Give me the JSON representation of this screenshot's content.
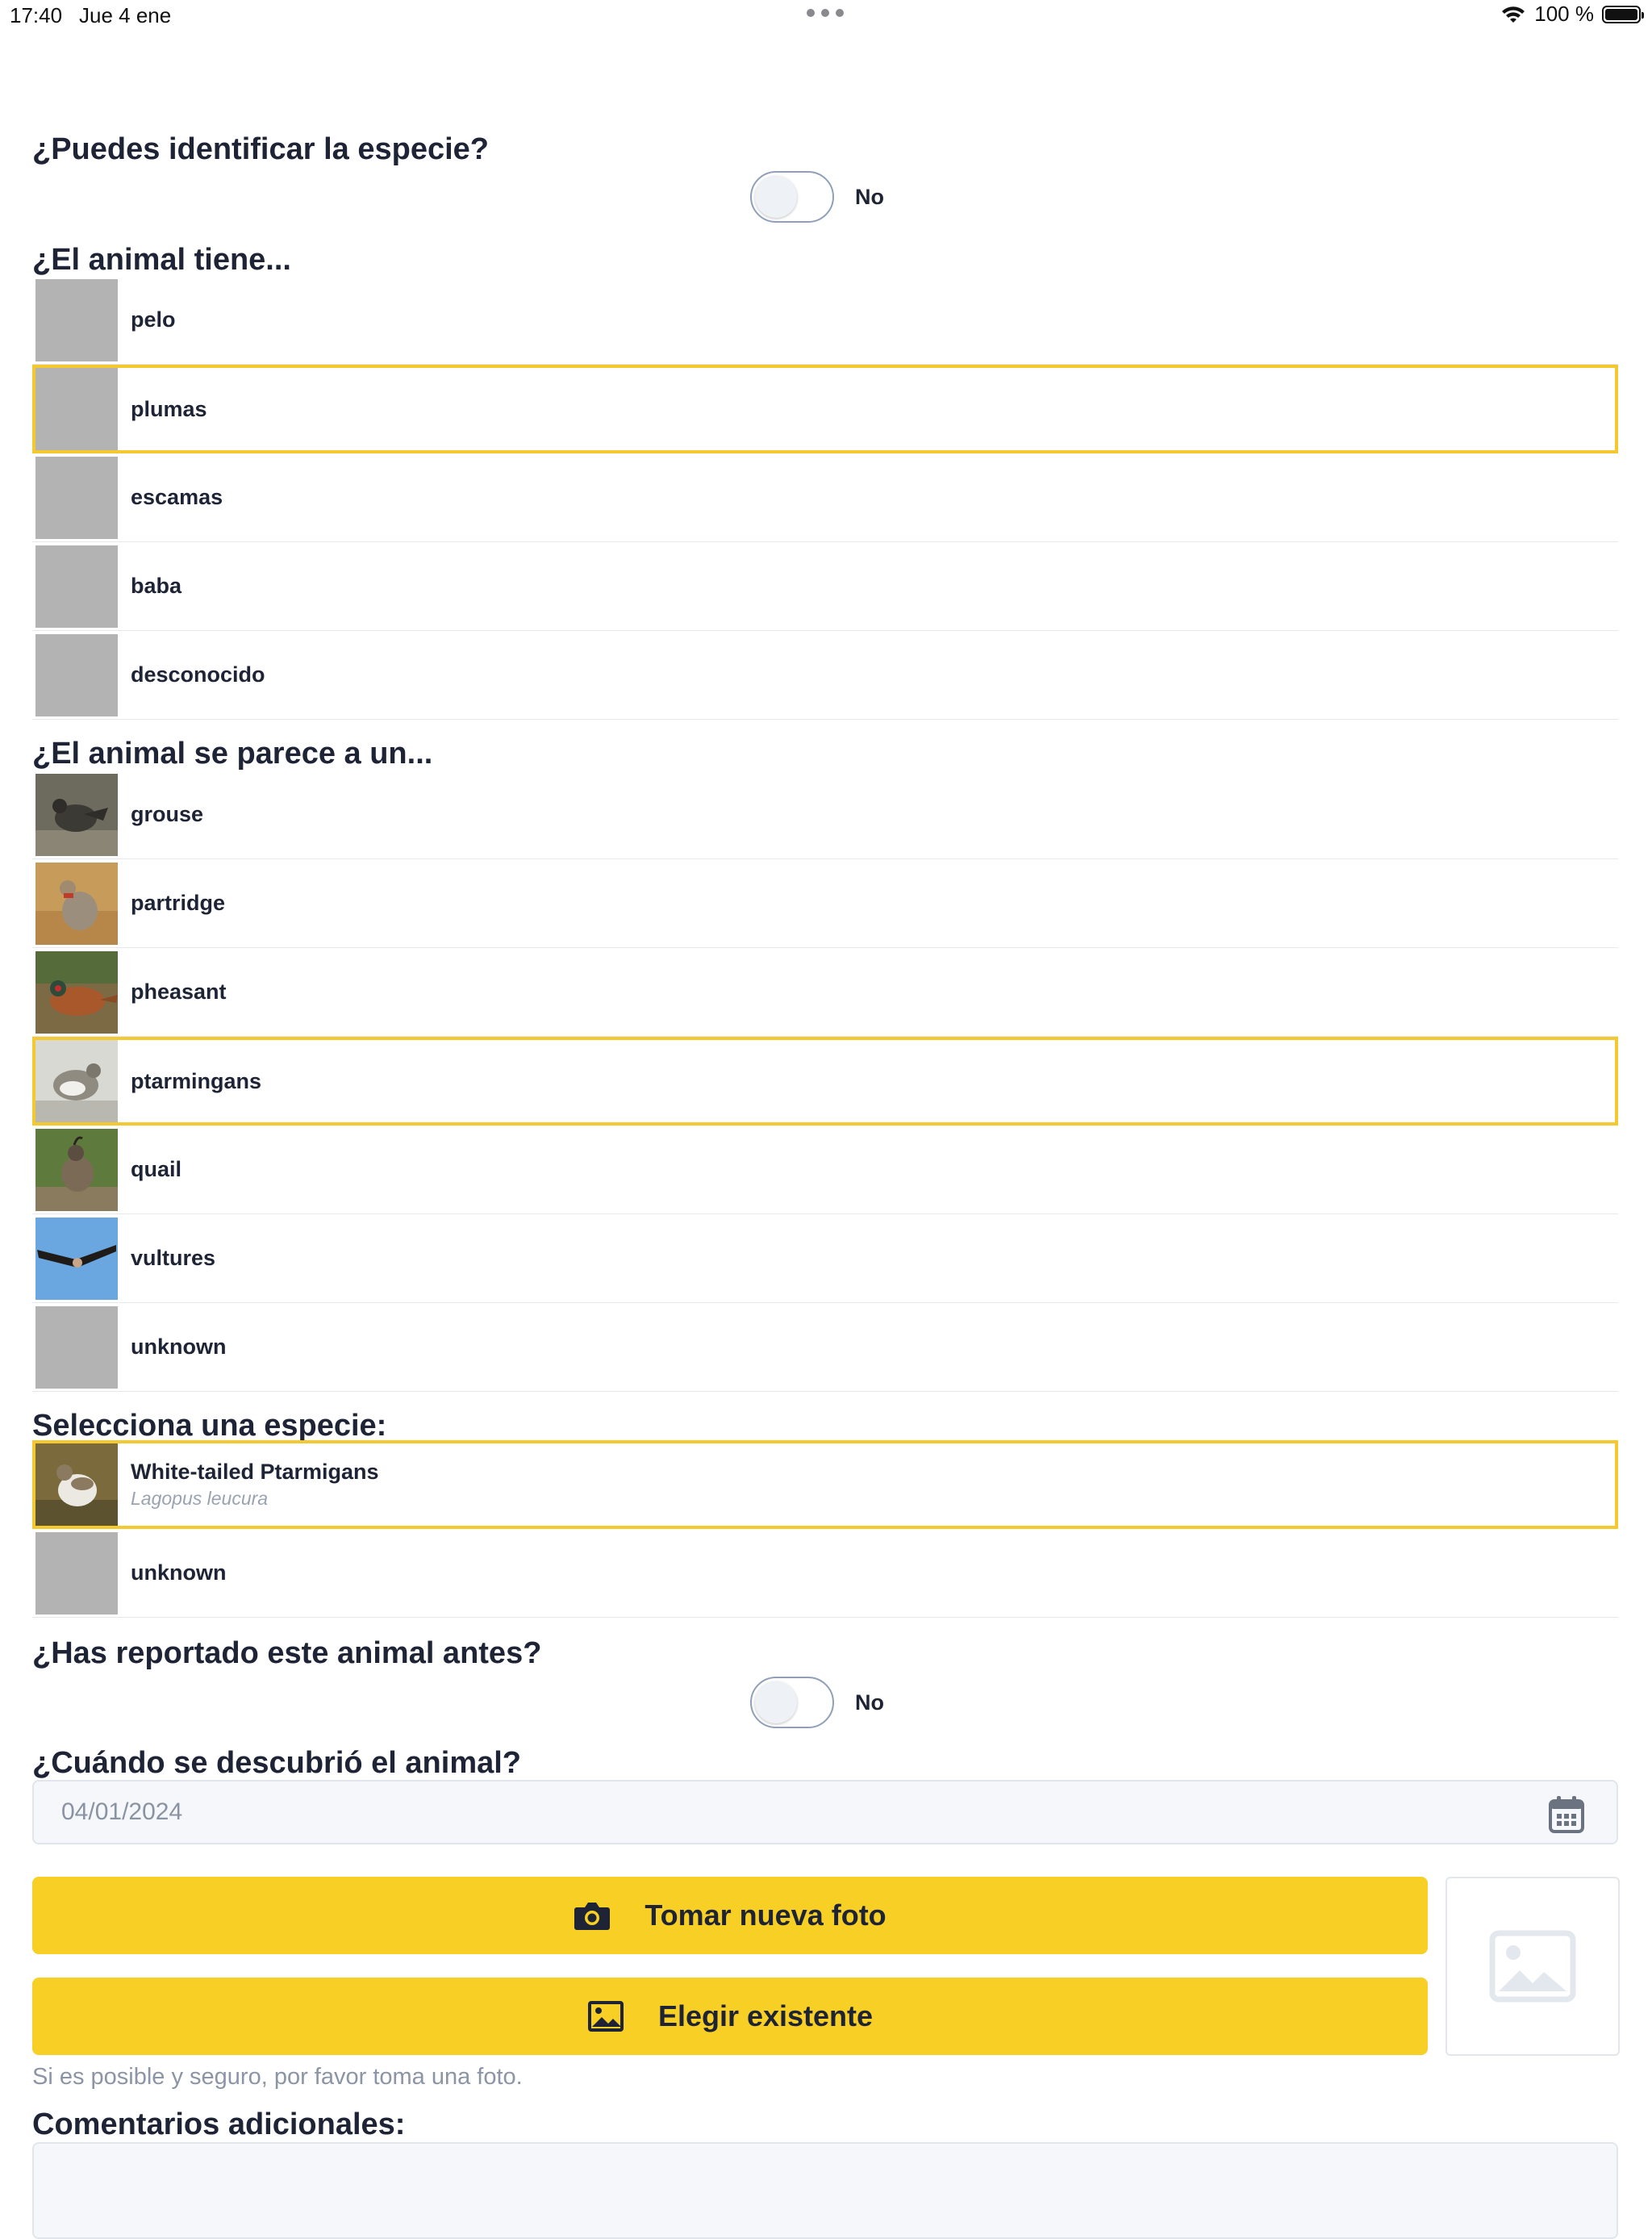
{
  "status_bar": {
    "time": "17:40",
    "date": "Jue 4 ene",
    "battery": "100 %"
  },
  "q_identify": {
    "title": "¿Puedes identificar la especie?",
    "toggle_label": "No"
  },
  "q_covering": {
    "title": "¿El animal tiene...",
    "options": [
      {
        "label": "pelo",
        "selected": false
      },
      {
        "label": "plumas",
        "selected": true
      },
      {
        "label": "escamas",
        "selected": false
      },
      {
        "label": "baba",
        "selected": false
      },
      {
        "label": "desconocido",
        "selected": false
      }
    ]
  },
  "q_resembles": {
    "title": "¿El animal se parece a un...",
    "options": [
      {
        "label": "grouse",
        "selected": false,
        "thumb": "grouse-photo"
      },
      {
        "label": "partridge",
        "selected": false,
        "thumb": "partridge-photo"
      },
      {
        "label": "pheasant",
        "selected": false,
        "thumb": "pheasant-photo"
      },
      {
        "label": "ptarmingans",
        "selected": true,
        "thumb": "ptarmigan-photo"
      },
      {
        "label": "quail",
        "selected": false,
        "thumb": "quail-photo"
      },
      {
        "label": "vultures",
        "selected": false,
        "thumb": "vulture-photo"
      },
      {
        "label": "unknown",
        "selected": false,
        "thumb": "placeholder"
      }
    ]
  },
  "q_species": {
    "title": "Selecciona una especie:",
    "options": [
      {
        "label": "White-tailed Ptarmigans",
        "scientific": "Lagopus leucura",
        "selected": true
      },
      {
        "label": "unknown",
        "selected": false
      }
    ]
  },
  "q_reported": {
    "title": "¿Has reportado este animal antes?",
    "toggle_label": "No"
  },
  "q_date": {
    "title": "¿Cuándo se descubrió el animal?",
    "value": "04/01/2024"
  },
  "photo": {
    "take_label": "Tomar nueva foto",
    "choose_label": "Elegir existente",
    "hint": "Si es posible y seguro, por favor toma una foto."
  },
  "comments": {
    "title": "Comentarios adicionales:"
  },
  "colors": {
    "accent": "#f8cf25",
    "selected_border": "#f3c92f",
    "heading": "#1e2435"
  }
}
